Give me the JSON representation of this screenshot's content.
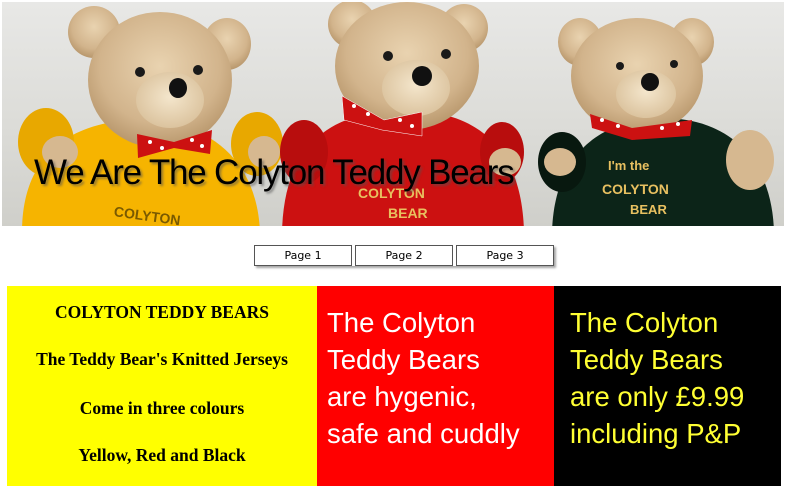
{
  "banner": {
    "title": "We Are The Colyton Teddy Bears",
    "bears": [
      {
        "sweater_color": "#f6b400",
        "sweater_text": "COLYTON"
      },
      {
        "sweater_color": "#cc1111",
        "sweater_text_top": "COLYTON",
        "sweater_text_bottom": "BEAR"
      },
      {
        "sweater_color": "#0c2418",
        "sweater_text_top": "I'm the",
        "sweater_text_mid": "COLYTON",
        "sweater_text_bottom": "BEAR"
      }
    ]
  },
  "nav": {
    "page1": "Page 1",
    "page2": "Page 2",
    "page3": "Page 3"
  },
  "panels": {
    "yellow": {
      "bg": "#ffff00",
      "line1": "COLYTON TEDDY BEARS",
      "line2": "The Teddy Bear's Knitted Jerseys",
      "line3": "Come in three colours",
      "line4": "Yellow, Red and Black"
    },
    "red": {
      "bg": "#ff0000",
      "line1": "The Colyton",
      "line2": "Teddy Bears",
      "line3": "are hygenic,",
      "line4": "safe and cuddly"
    },
    "black": {
      "bg": "#000000",
      "line1": "The Colyton",
      "line2": "Teddy Bears",
      "line3": "are only £9.99",
      "line4": "including P&P"
    }
  }
}
